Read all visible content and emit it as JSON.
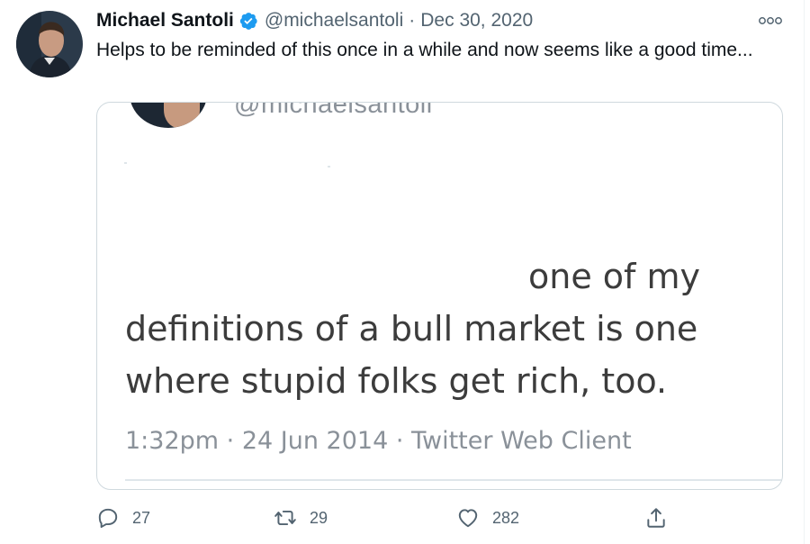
{
  "tweet": {
    "display_name": "Michael Santoli",
    "handle": "@michaelsantoli",
    "date": "Dec 30, 2020",
    "text": "Helps to be reminded of this once in a while and now seems like a good time...",
    "verified": true
  },
  "embedded_screenshot": {
    "handle": "@michaelsantoli",
    "line1": "one of my",
    "line2": "definitions of a bull market is one",
    "line3": "where stupid folks get rich, too.",
    "timestamp": "1:32pm · 24 Jun 2014 · Twitter Web Client"
  },
  "actions": {
    "reply_count": "27",
    "retweet_count": "29",
    "like_count": "282"
  },
  "icons": {
    "verified": "verified-badge-icon",
    "more": "more-options-icon",
    "reply": "reply-icon",
    "retweet": "retweet-icon",
    "like": "heart-icon",
    "share": "share-icon"
  },
  "colors": {
    "accent": "#1d9bf0",
    "text": "#0f1419",
    "secondary": "#536471",
    "border": "#cfd9de"
  }
}
